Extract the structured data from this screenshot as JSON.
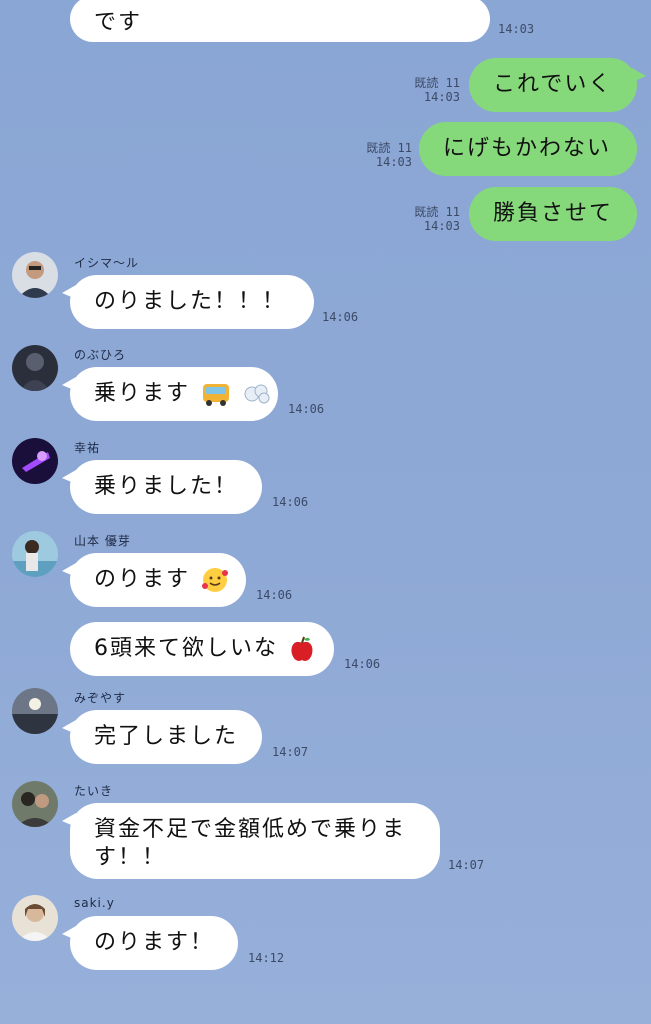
{
  "messages": [
    {
      "text": "です",
      "time": "14:03"
    },
    {
      "text": "これでいく",
      "read": "既読 11",
      "time": "14:03"
    },
    {
      "text": "にげもかわない",
      "read": "既読 11",
      "time": "14:03"
    },
    {
      "text": "勝負させて",
      "read": "既読 11",
      "time": "14:03"
    },
    {
      "sender": "イシマ〜ル",
      "text": "のりました！！！",
      "time": "14:06"
    },
    {
      "sender": "のぶひろ",
      "text": "乗ります",
      "emoji": "bus-icon, dash-icon",
      "time": "14:06"
    },
    {
      "sender": "幸祐",
      "text": "乗りました！",
      "time": "14:06"
    },
    {
      "sender": "山本 優芽",
      "text": "のります",
      "emoji": "smiling-face-hearts-icon",
      "time": "14:06"
    },
    {
      "text": "6頭来て欲しいな",
      "emoji": "apple-icon",
      "time": "14:06"
    },
    {
      "sender": "みぞやす",
      "text": "完了しました",
      "time": "14:07"
    },
    {
      "sender": "たいき",
      "text": "資金不足で金額低めで乗ります！！",
      "time": "14:07"
    },
    {
      "sender": "saki.y",
      "text": "のります！",
      "time": "14:12"
    }
  ],
  "colors": {
    "background": "#8fa9d6",
    "incoming_bubble": "#ffffff",
    "outgoing_bubble": "#86d97b"
  }
}
